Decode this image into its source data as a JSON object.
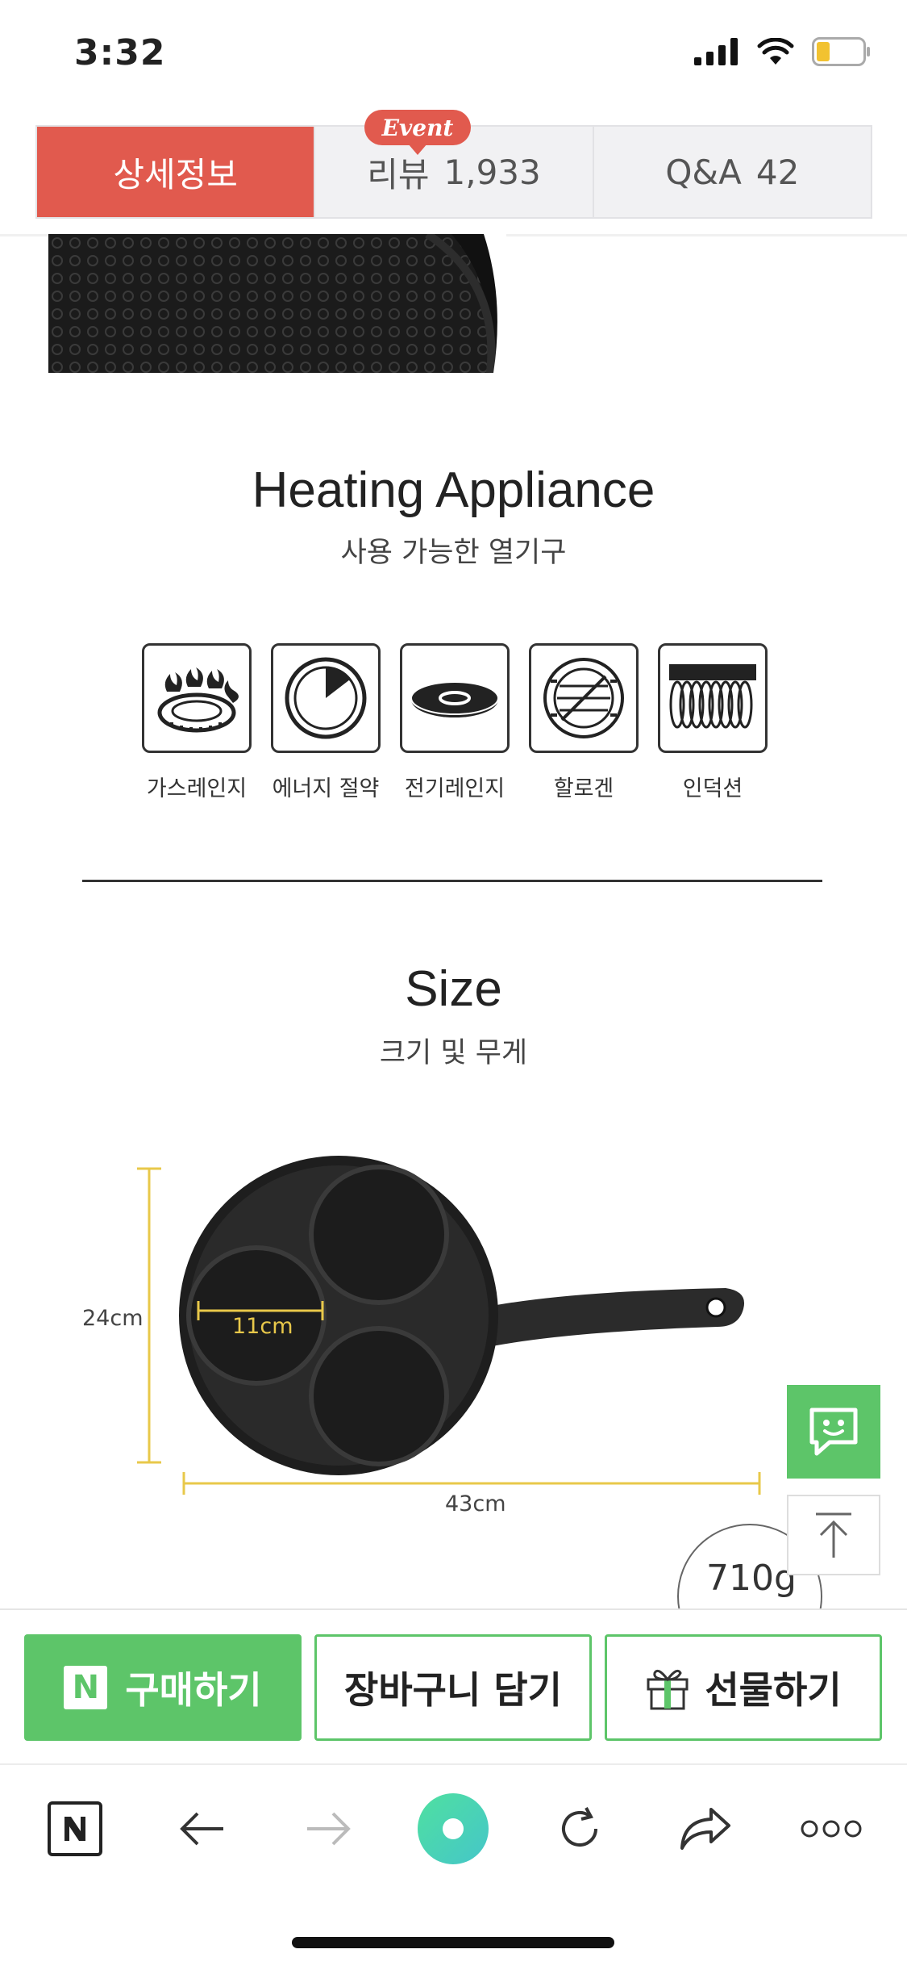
{
  "status_bar": {
    "time": "3:32"
  },
  "tabs": [
    {
      "label": "상세정보",
      "active": true
    },
    {
      "label": "리뷰",
      "count": "1,933",
      "active": false
    },
    {
      "label": "Q&A",
      "count": "42",
      "active": false
    }
  ],
  "event_badge": "Event",
  "heating": {
    "title": "Heating Appliance",
    "subtitle": "사용 가능한 열기구",
    "items": [
      {
        "label": "가스레인지",
        "icon": "gas-stove-icon"
      },
      {
        "label": "에너지 절약",
        "icon": "energy-saving-icon"
      },
      {
        "label": "전기레인지",
        "icon": "electric-stove-icon"
      },
      {
        "label": "할로겐",
        "icon": "halogen-icon"
      },
      {
        "label": "인덕션",
        "icon": "induction-icon"
      }
    ]
  },
  "size": {
    "title": "Size",
    "subtitle": "크기 및 무게",
    "height": "24cm",
    "cup_diameter": "11cm",
    "length": "43cm",
    "weight": "710g"
  },
  "purchase": {
    "buy_label": "구매하기",
    "cart_label": "장바구니 담기",
    "gift_label": "선물하기"
  },
  "colors": {
    "tab_active": "#e15a4e",
    "naver_green": "#5dc569",
    "dimension_line": "#e8c84a"
  }
}
